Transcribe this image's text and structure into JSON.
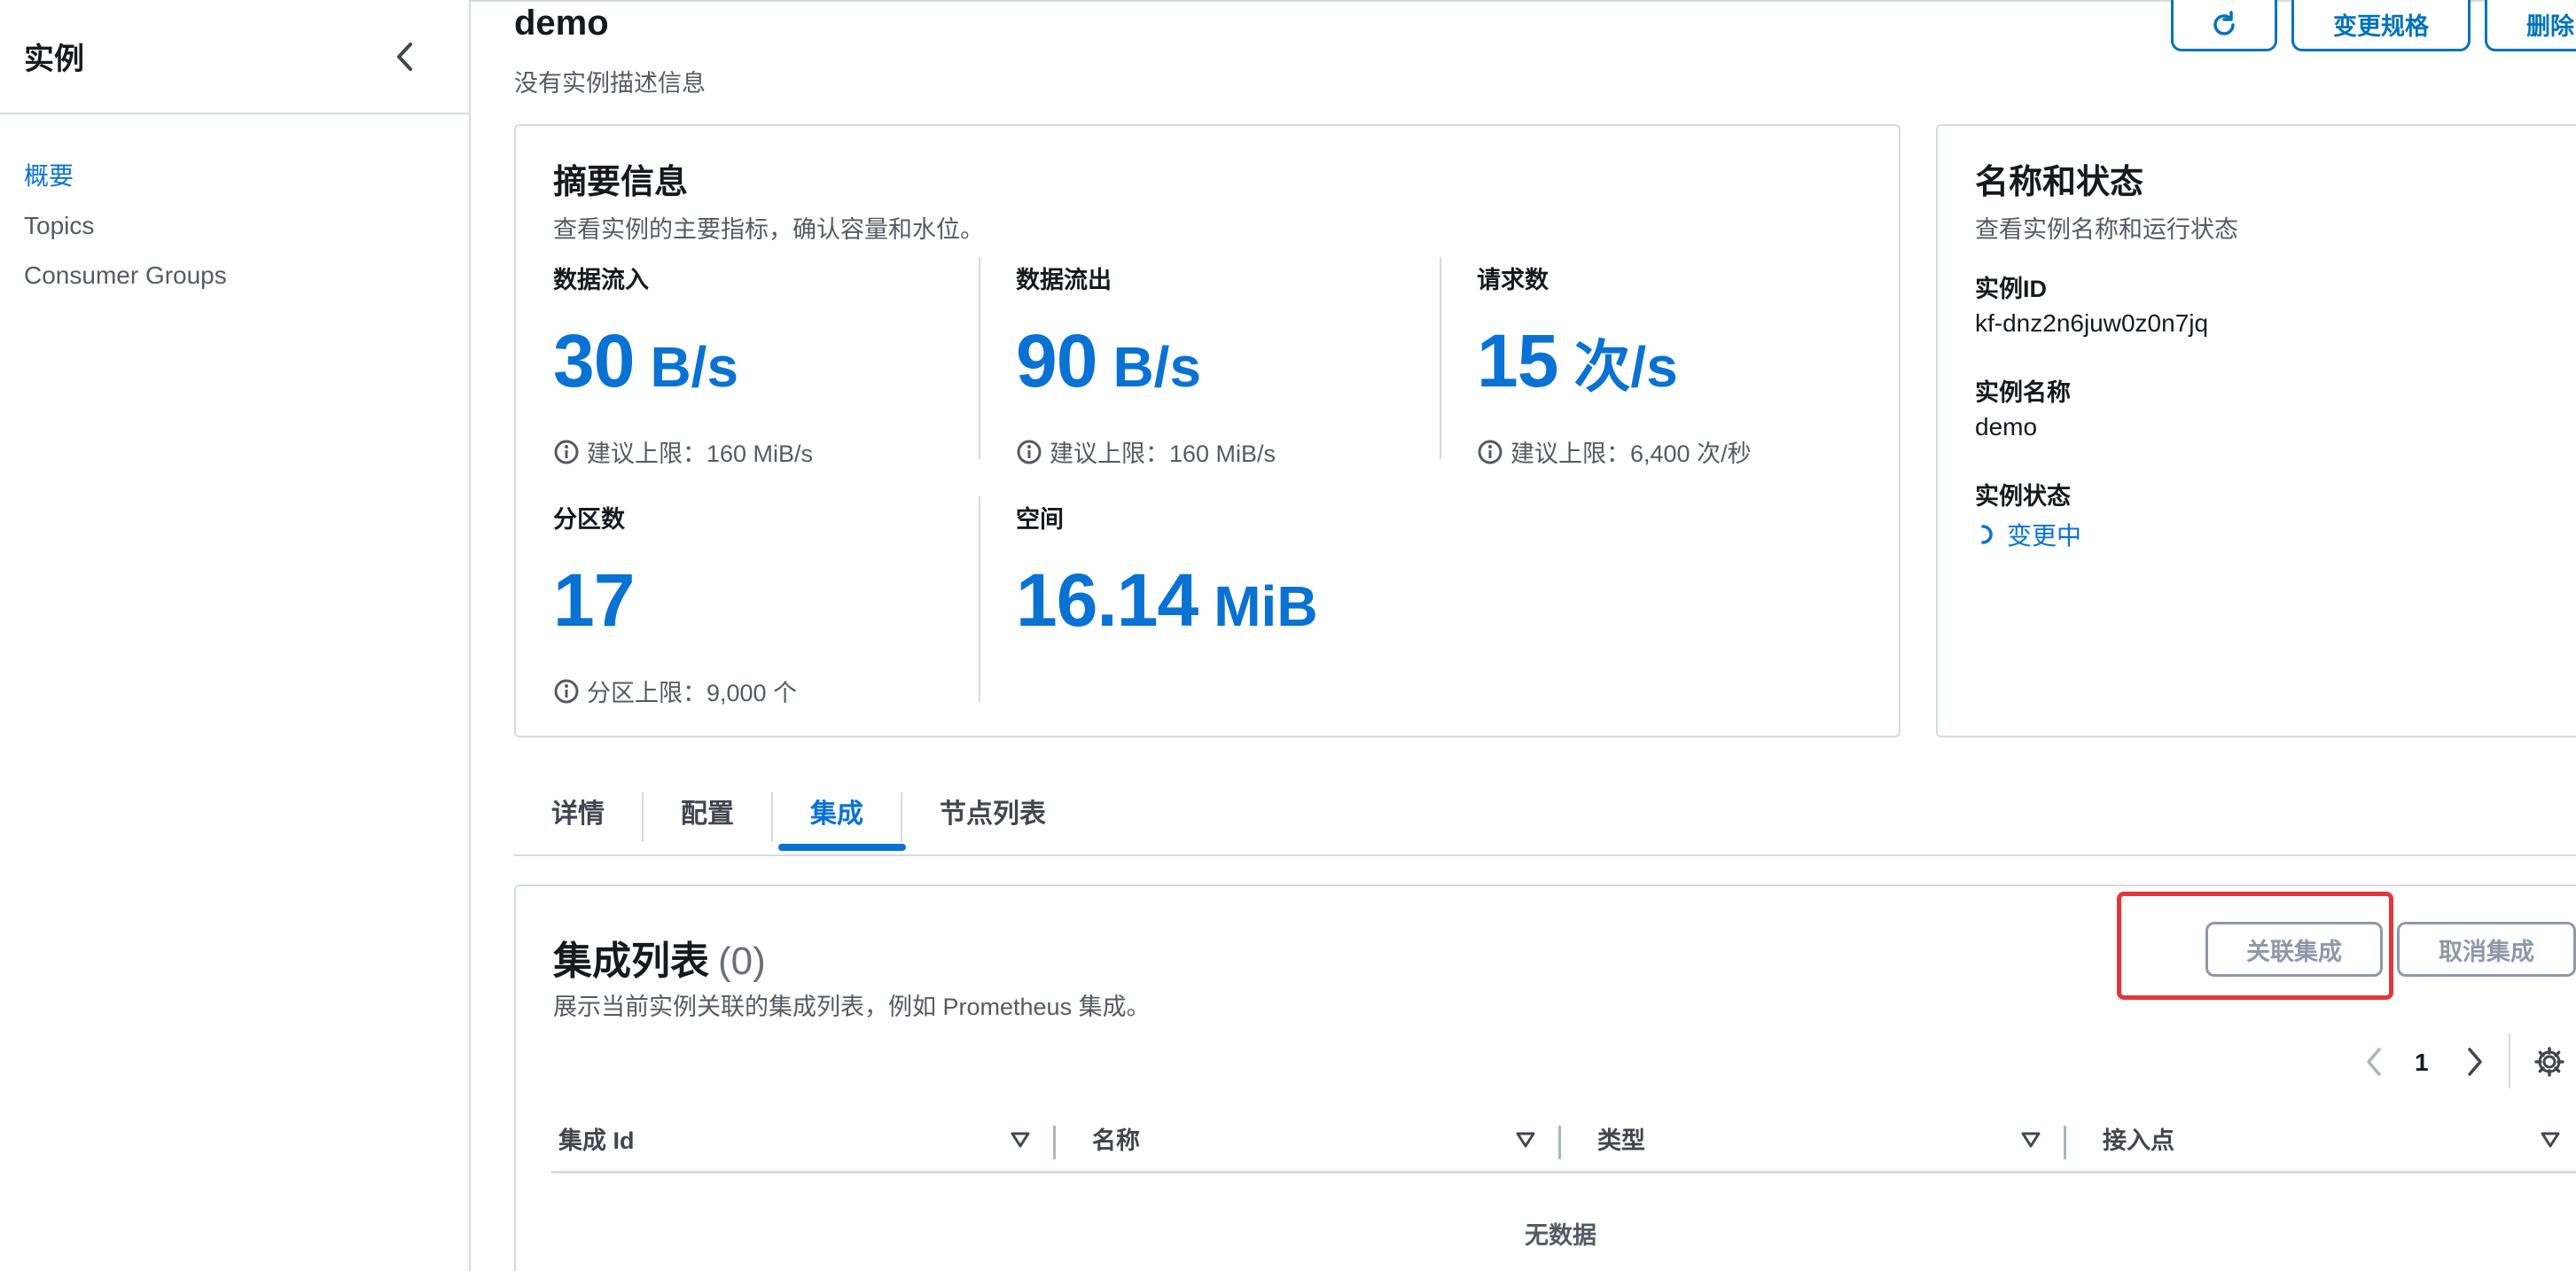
{
  "sidebar": {
    "title": "实例",
    "items": [
      {
        "label": "概要",
        "active": true
      },
      {
        "label": "Topics",
        "active": false
      },
      {
        "label": "Consumer Groups",
        "active": false
      }
    ]
  },
  "header": {
    "title": "demo",
    "description": "没有实例描述信息",
    "buttons": {
      "refresh_icon": "refresh-icon",
      "resize_label": "变更规格",
      "delete_label": "删除"
    }
  },
  "summary": {
    "title": "摘要信息",
    "subtitle": "查看实例的主要指标，确认容量和水位。",
    "metrics": [
      {
        "label": "数据流入",
        "value": "30",
        "unit": "B/s",
        "hint": "建议上限：160 MiB/s"
      },
      {
        "label": "数据流出",
        "value": "90",
        "unit": "B/s",
        "hint": "建议上限：160 MiB/s"
      },
      {
        "label": "请求数",
        "value": "15",
        "unit": "次/s",
        "hint": "建议上限：6,400 次/秒"
      },
      {
        "label": "分区数",
        "value": "17",
        "unit": "",
        "hint": "分区上限：9,000 个"
      },
      {
        "label": "空间",
        "value": "16.14",
        "unit": "MiB",
        "hint": ""
      }
    ]
  },
  "name_status": {
    "title": "名称和状态",
    "subtitle": "查看实例名称和运行状态",
    "instance_id_label": "实例ID",
    "instance_id": "kf-dnz2n6juw0z0n7jq",
    "instance_name_label": "实例名称",
    "instance_name": "demo",
    "instance_status_label": "实例状态",
    "instance_status": "变更中"
  },
  "tabs": [
    {
      "label": "详情",
      "active": false
    },
    {
      "label": "配置",
      "active": false
    },
    {
      "label": "集成",
      "active": true
    },
    {
      "label": "节点列表",
      "active": false
    }
  ],
  "integrations": {
    "title": "集成列表",
    "count": "(0)",
    "description": "展示当前实例关联的集成列表，例如 Prometheus 集成。",
    "associate_label": "关联集成",
    "cancel_label": "取消集成",
    "page": "1",
    "columns": [
      "集成 Id",
      "名称",
      "类型",
      "接入点"
    ],
    "empty_text": "无数据"
  },
  "colors": {
    "accent": "#0972d3",
    "border": "#d5dbdb",
    "highlight": "#e5343a"
  }
}
